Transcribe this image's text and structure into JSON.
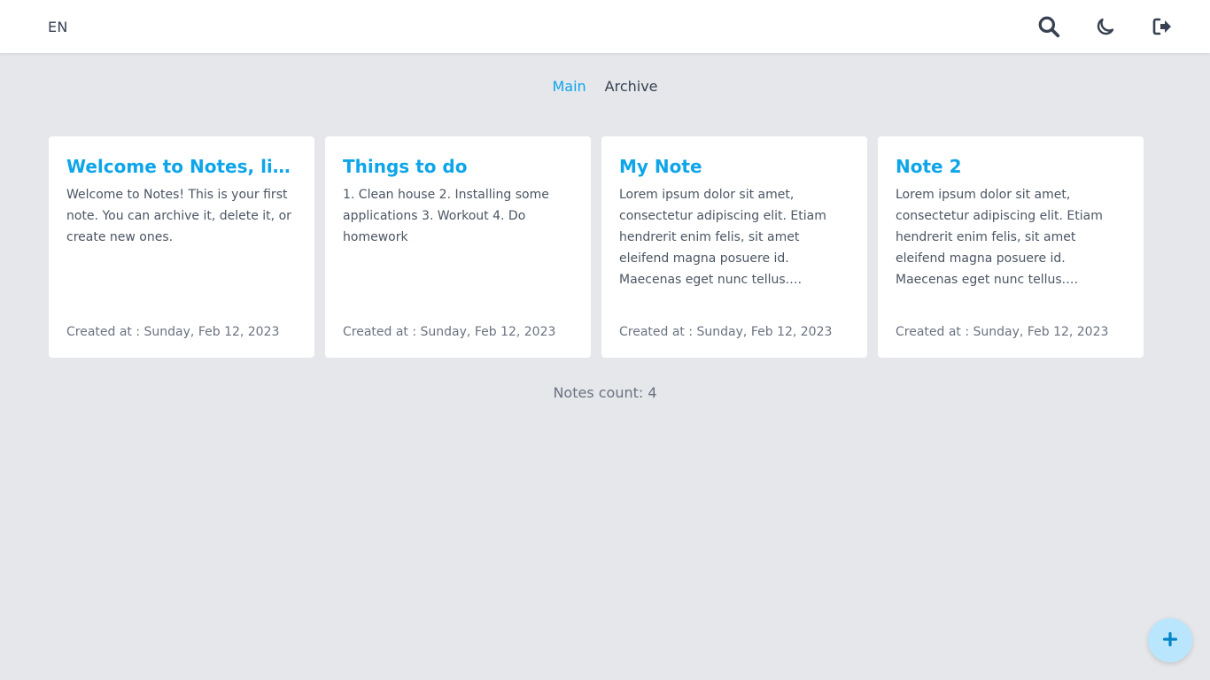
{
  "header": {
    "language": "EN",
    "icons": [
      "search-icon",
      "moon-icon",
      "logout-icon"
    ]
  },
  "tabs": [
    {
      "label": "Main",
      "active": true
    },
    {
      "label": "Archive",
      "active": false
    }
  ],
  "notes": [
    {
      "title": "Welcome to Notes, lipsum",
      "body": "Welcome to Notes! This is your first note. You can archive it, delete it, or create new ones.",
      "date": "Created at : Sunday, Feb 12, 2023"
    },
    {
      "title": "Things to do",
      "body": "1. Clean house 2. Installing some applications 3. Workout 4. Do homework",
      "date": "Created at : Sunday, Feb 12, 2023"
    },
    {
      "title": "My Note",
      "body": "Lorem ipsum dolor sit amet, consectetur adipiscing elit. Etiam hendrerit enim felis, sit amet eleifend magna posuere id. Maecenas eget nunc tellus. Vestibulum quis risus nec",
      "date": "Created at : Sunday, Feb 12, 2023"
    },
    {
      "title": "Note 2",
      "body": "Lorem ipsum dolor sit amet, consectetur adipiscing elit. Etiam hendrerit enim felis, sit amet eleifend magna posuere id. Maecenas eget nunc tellus. Vestibulum quis risus nec",
      "date": "Created at : Sunday, Feb 12, 2023"
    }
  ],
  "footer": {
    "count_label": "Notes count: 4"
  },
  "fab": {
    "icon": "plus-icon"
  },
  "colors": {
    "accent": "#0ea5e9",
    "background": "#e5e7eb",
    "fab": "#bae6fd"
  }
}
